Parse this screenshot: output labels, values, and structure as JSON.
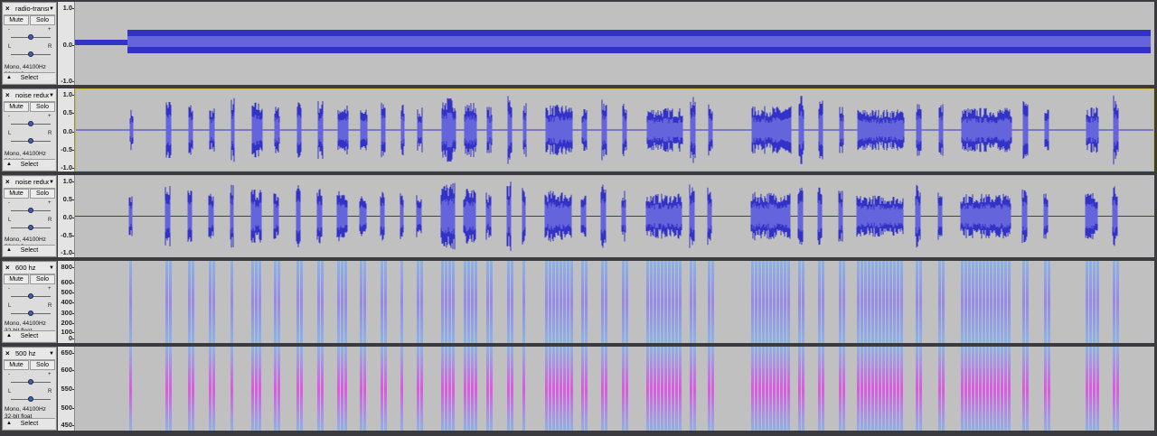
{
  "common": {
    "mute_label": "Mute",
    "solo_label": "Solo",
    "gain_minus": "-",
    "gain_plus": "+",
    "pan_left": "L",
    "pan_right": "R",
    "format_line1": "Mono, 44100Hz",
    "format_line2": "32-bit float",
    "select_label": "Select",
    "close_glyph": "×",
    "menu_glyph": "▼",
    "collapse_glyph": "▲"
  },
  "colors": {
    "waveform": "#3232c8",
    "waveform_rms": "#6464dc",
    "spectro_low": "#7fb0f0",
    "spectro_mid": "#8c7cf0",
    "spectro_high": "#e040e8",
    "track_bg": "#c0c0c0",
    "selected_border": "#c9b94a"
  },
  "tracks": [
    {
      "name": "radio-transmi",
      "type": "waveform",
      "ticks": [
        "1.0",
        "0.0",
        "-1.0"
      ]
    },
    {
      "name": "noise reduce",
      "type": "waveform",
      "selected": true,
      "ticks": [
        "1.0",
        "0.5",
        "0.0",
        "-0.5",
        "-1.0"
      ]
    },
    {
      "name": "noise reduce",
      "type": "waveform",
      "ticks": [
        "1.0",
        "0.5",
        "0.0",
        "-0.5",
        "-1.0"
      ]
    },
    {
      "name": "600 hz",
      "type": "spectrogram",
      "ticks": [
        "800",
        "600",
        "500",
        "400",
        "300",
        "200",
        "100",
        "0"
      ]
    },
    {
      "name": "500 hz",
      "type": "spectrogram",
      "ticks": [
        "650",
        "600",
        "550",
        "500",
        "450"
      ]
    }
  ]
}
